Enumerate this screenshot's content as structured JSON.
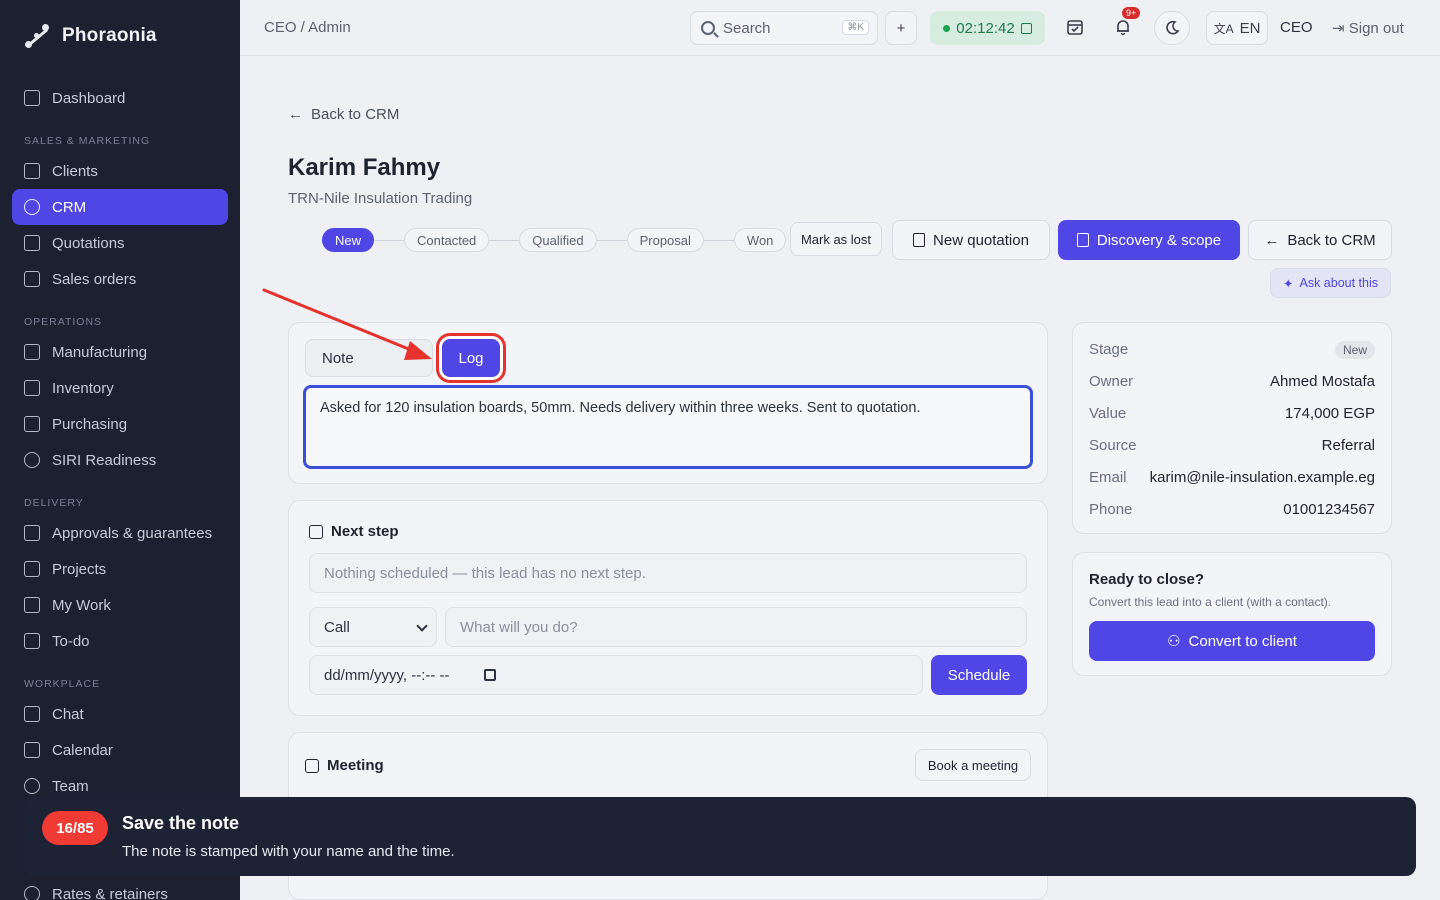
{
  "brand": {
    "name": "Phoraonia"
  },
  "sidebar": {
    "items": [
      {
        "label": "Dashboard"
      },
      {
        "label": "Clients"
      },
      {
        "label": "CRM"
      },
      {
        "label": "Quotations"
      },
      {
        "label": "Sales orders"
      },
      {
        "label": "Manufacturing"
      },
      {
        "label": "Inventory"
      },
      {
        "label": "Purchasing"
      },
      {
        "label": "SIRI Readiness"
      },
      {
        "label": "Approvals & guarantees"
      },
      {
        "label": "Projects"
      },
      {
        "label": "My Work"
      },
      {
        "label": "To-do"
      },
      {
        "label": "Chat"
      },
      {
        "label": "Calendar"
      },
      {
        "label": "Team"
      },
      {
        "label": "Rates & retainers"
      }
    ],
    "sections": {
      "sales": "SALES & MARKETING",
      "operations": "OPERATIONS",
      "delivery": "DELIVERY",
      "workplace": "WORKPLACE"
    }
  },
  "topbar": {
    "breadcrumb": "CEO / Admin",
    "search_label": "Search",
    "search_kbd": "⌘K",
    "plus": "+",
    "timer": "02:12:42",
    "notif_badge": "9+",
    "lang": "EN",
    "role": "CEO",
    "signout": "Sign out"
  },
  "lead": {
    "back": "Back to CRM",
    "name": "Karim Fahmy",
    "company": "TRN-Nile Insulation Trading",
    "stages": [
      "New",
      "Contacted",
      "Qualified",
      "Proposal",
      "Won"
    ],
    "mark_lost": "Mark as lost",
    "new_quotation": "New quotation",
    "discovery": "Discovery & scope",
    "back_crm": "Back to CRM",
    "ask": "Ask about this"
  },
  "note_card": {
    "tab_note": "Note",
    "tab_log": "Log",
    "text": "Asked for 120 insulation boards, 50mm. Needs delivery within three weeks. Sent to quotation."
  },
  "next_step": {
    "title": "Next step",
    "empty": "Nothing scheduled — this lead has no next step.",
    "type_value": "Call",
    "what_placeholder": "What will you do?",
    "date_placeholder": "dd/mm/yyyy, --:-- --",
    "schedule": "Schedule"
  },
  "meeting": {
    "title": "Meeting",
    "book": "Book a meeting"
  },
  "details": {
    "stage_label": "Stage",
    "stage_value": "New",
    "owner_label": "Owner",
    "owner_value": "Ahmed Mostafa",
    "value_label": "Value",
    "value_value": "174,000 EGP",
    "source_label": "Source",
    "source_value": "Referral",
    "email_label": "Email",
    "email_value": "karim@nile-insulation.example.eg",
    "phone_label": "Phone",
    "phone_value": "01001234567"
  },
  "close_card": {
    "title": "Ready to close?",
    "subtitle": "Convert this lead into a client (with a contact).",
    "button": "Convert to client"
  },
  "toast": {
    "count": "16/85",
    "title": "Save the note",
    "body": "The note is stamped with your name and the time."
  },
  "colors": {
    "accent": "#4f46e5",
    "sidebar": "#1c2030",
    "highlight": "#e5322d"
  }
}
